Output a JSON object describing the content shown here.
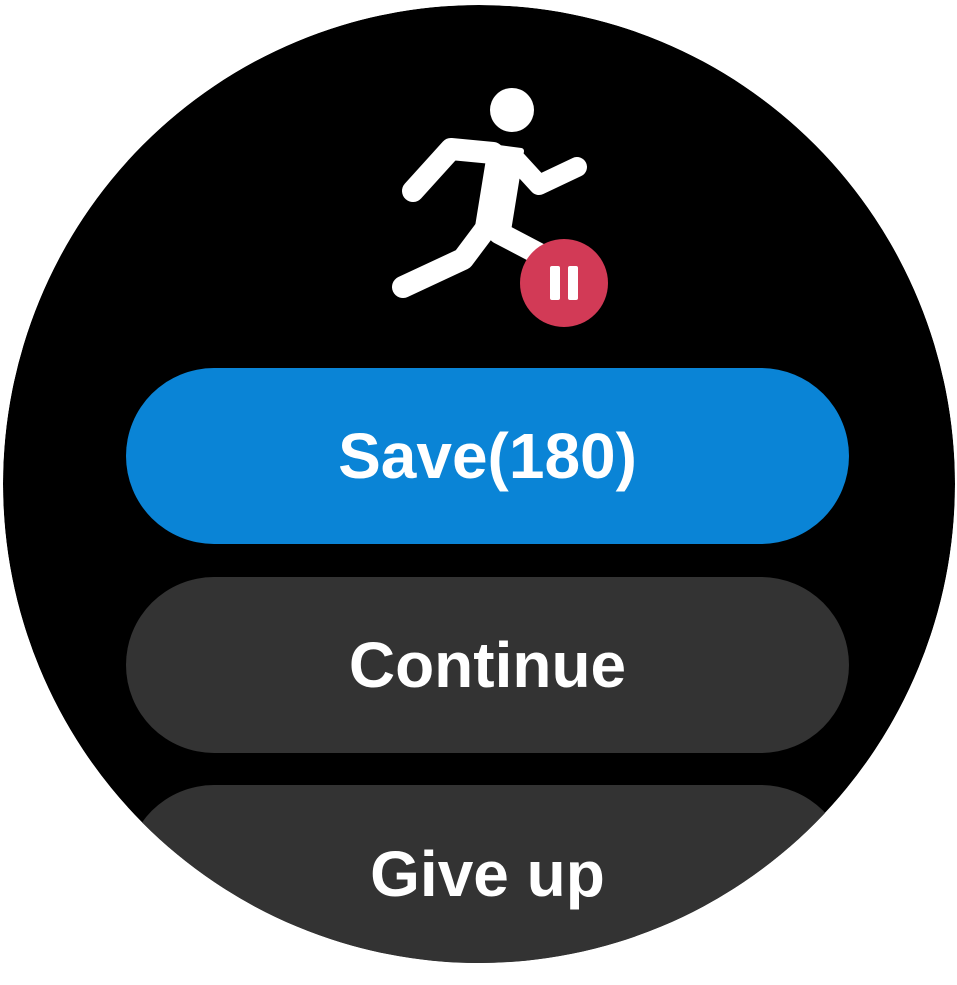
{
  "app": {
    "activity_icon": "running-person-icon",
    "status_icon": "pause-icon"
  },
  "actions": {
    "save_label": "Save(180)",
    "continue_label": "Continue",
    "giveup_label": "Give up"
  },
  "colors": {
    "background": "#000000",
    "primary_button": "#0a84d6",
    "secondary_button": "#333333",
    "pause_badge": "#d23a56",
    "text": "#ffffff"
  }
}
